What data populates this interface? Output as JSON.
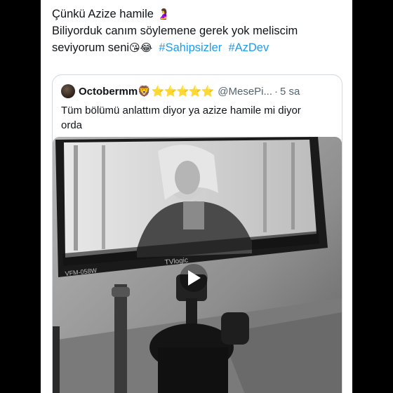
{
  "post": {
    "line1_text": "Çünkü Azize hamile",
    "line1_emoji": "🤰",
    "line2_text": "Biliyorduk canım söylemene gerek yok meliscim",
    "line3_text": "seviyorum seni",
    "line3_emojis": "😘😂",
    "hashtags": [
      "#Sahipsizler",
      "#AzDev"
    ]
  },
  "quote": {
    "name": "Octobermm",
    "name_emoji": "🦁",
    "badges": "⭐⭐⭐⭐⭐",
    "handle": "@MesePi...",
    "separator": "·",
    "time": "5 sa",
    "text_line1": "Tüm bölümü anlattım diyor ya azize hamile mi diyor",
    "text_line2": "orda"
  },
  "media": {
    "type": "video",
    "play_icon": "play-icon",
    "monitor_labels": [
      "VFM-058W",
      "TVlogic"
    ]
  }
}
